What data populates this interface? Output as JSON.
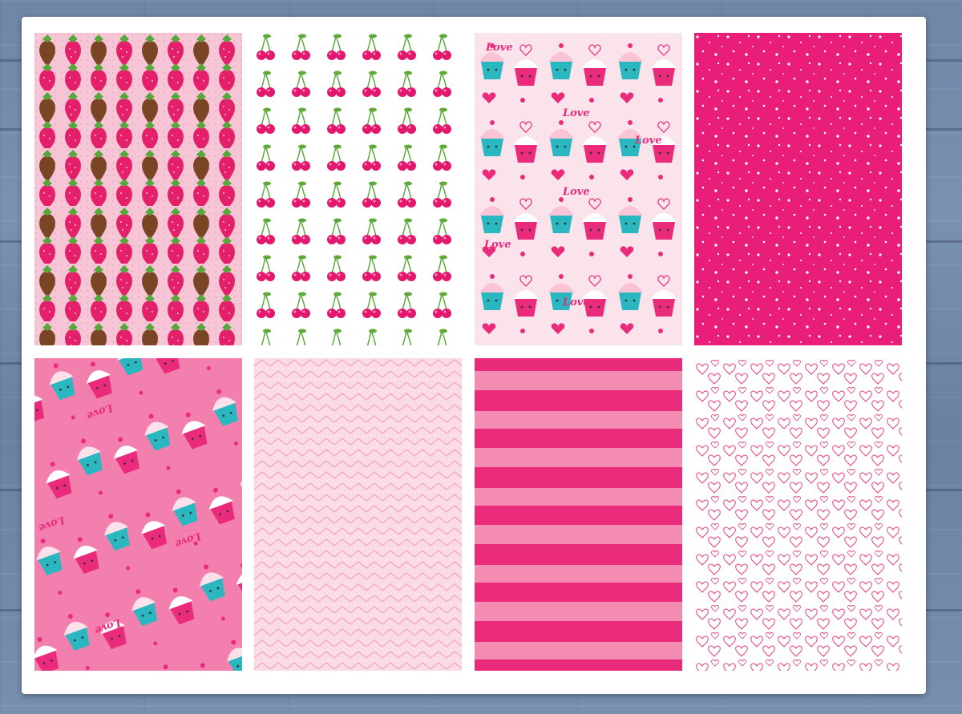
{
  "patterns": [
    {
      "name": "chocolate-strawberries",
      "background": "#f7c6d6",
      "accent": "#e4206a",
      "secondary": "#7a4524"
    },
    {
      "name": "cherries",
      "background": "#ffffff",
      "accent": "#e4176e",
      "secondary": "#5ea93a"
    },
    {
      "name": "cupcakes-love-light",
      "background": "#fbe3ec",
      "accent": "#ea2a7b",
      "secondary": "#2bb7c0",
      "text": "Love"
    },
    {
      "name": "white-dots-on-pink",
      "background": "#e91e79",
      "accent": "#ffffff"
    },
    {
      "name": "cupcakes-love-pink",
      "background": "#f27fae",
      "accent": "#ea2a7b",
      "secondary": "#2bb7c0",
      "text": "Love"
    },
    {
      "name": "pink-chevron",
      "background": "#fbdbe5",
      "accent": "#f5a8c1"
    },
    {
      "name": "pink-stripes",
      "background": "#ea2a7b",
      "accent": "#f48bb3"
    },
    {
      "name": "heart-outlines",
      "background": "#ffffff",
      "accent": "#e4407c"
    }
  ],
  "colors": {
    "background_wood": "#7089a8",
    "sheet": "#ffffff"
  }
}
